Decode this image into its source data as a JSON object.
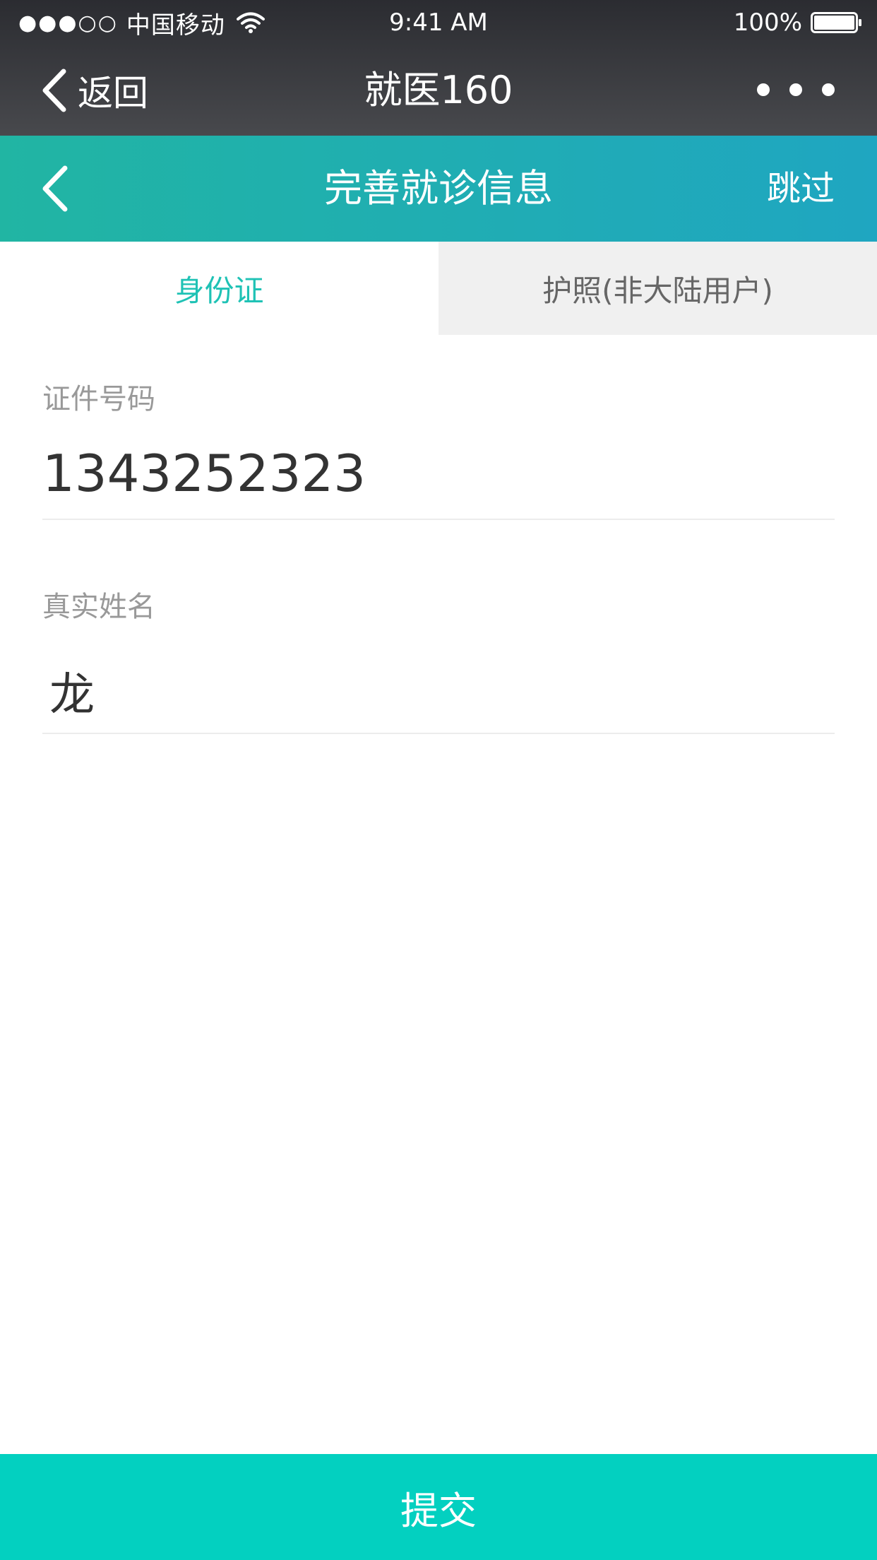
{
  "status_bar": {
    "signal": "●●●○○",
    "carrier": "中国移动",
    "time": "9:41 AM",
    "battery": "100%"
  },
  "wechat_nav": {
    "back_label": "返回",
    "title": "就医160"
  },
  "header": {
    "title": "完善就诊信息",
    "skip_label": "跳过"
  },
  "tabs": [
    {
      "label": "身份证",
      "active": true
    },
    {
      "label": "护照(非大陆用户)",
      "active": false
    }
  ],
  "form": {
    "id_number": {
      "label": "证件号码",
      "value": "1343252323"
    },
    "real_name": {
      "label": "真实姓名",
      "value": "龙"
    }
  },
  "submit_label": "提交",
  "colors": {
    "accent": "#1fc2b5",
    "submit_bg": "#03d0c0",
    "header_gradient_start": "#21b5a3",
    "header_gradient_end": "#1fa6c1"
  }
}
